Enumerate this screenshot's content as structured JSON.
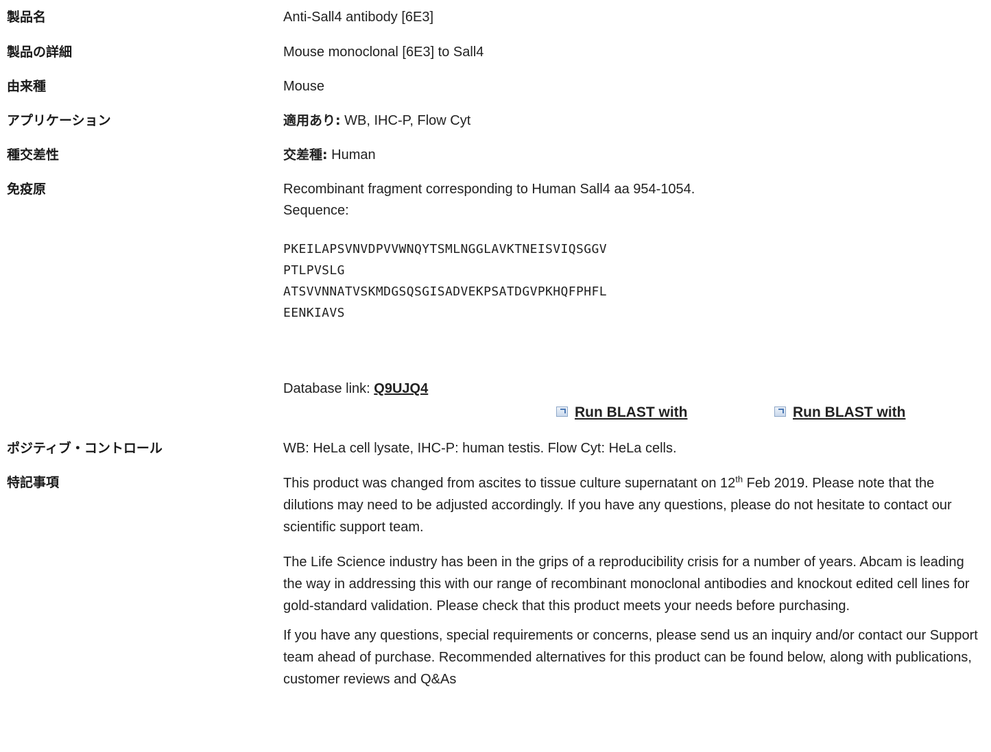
{
  "rows": {
    "product_name": {
      "label": "製品名",
      "value": "Anti-Sall4 antibody [6E3]"
    },
    "product_detail": {
      "label": "製品の詳細",
      "value": "Mouse monoclonal [6E3] to Sall4"
    },
    "host": {
      "label": "由来種",
      "value": "Mouse"
    },
    "applications": {
      "label": "アプリケーション",
      "prefix": "適用あり:",
      "value": " WB, IHC-P, Flow Cyt"
    },
    "reactivity": {
      "label": "種交差性",
      "prefix": "交差種:",
      "value": " Human"
    },
    "immunogen": {
      "label": "免疫原",
      "line1": "Recombinant fragment corresponding to Human Sall4 aa 954-1054.",
      "line2": "Sequence:",
      "sequence": [
        "PKEILAPSVNVDPVVWNQYTSMLNGGLAVKTNEISVIQSGGV",
        "PTLPVSLG",
        "ATSVVNNATVSKMDGSQSGISADVEKPSATDGVPKHQFPHFL",
        "EENKIAVS"
      ],
      "db_label": "Database link: ",
      "db_link": "Q9UJQ4",
      "blast1": "Run BLAST with",
      "blast2": "Run BLAST with"
    },
    "positive_control": {
      "label": "ポジティブ・コントロール",
      "value": "WB: HeLa cell lysate, IHC-P: human testis. Flow Cyt: HeLa cells."
    },
    "notes": {
      "label": "特記事項",
      "p1_a": "This product was changed from ascites to tissue culture supernatant on 12",
      "p1_sup": "th",
      "p1_b": " Feb 2019. Please note that the dilutions may need to be adjusted accordingly. If you have any questions, please do not hesitate to contact our scientific support team.",
      "p2": "The Life Science industry has been in the grips of a reproducibility crisis for a number of years. Abcam is leading the way in addressing this with our range of recombinant monoclonal antibodies and knockout edited cell lines for gold-standard validation. Please check that this product meets your needs before purchasing.",
      "p3": "If you have any questions, special requirements or concerns, please send us an inquiry and/or contact our Support team ahead of purchase. Recommended alternatives for this product can be found below, along with publications, customer reviews and Q&As"
    }
  }
}
